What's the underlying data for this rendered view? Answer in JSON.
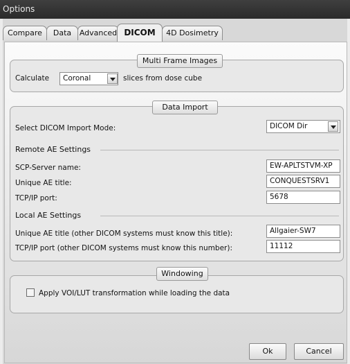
{
  "window": {
    "title": "Options"
  },
  "tabs": [
    "Compare",
    "Data",
    "Advanced",
    "DICOM",
    "4D Dosimetry"
  ],
  "multi_frame": {
    "title": "Multi Frame Images",
    "prefix": "Calculate",
    "orientation": "Coronal",
    "suffix": "slices from dose cube"
  },
  "data_import": {
    "title": "Data Import",
    "mode_label": "Select DICOM Import Mode:",
    "mode_value": "DICOM Dir",
    "remote_header": "Remote AE Settings",
    "scp_label": "SCP-Server name:",
    "scp_value": "EW-APLTSTVM-XP",
    "unique_ae_label": "Unique AE title:",
    "unique_ae_value": "CONQUESTSRV1",
    "tcp_label": "TCP/IP port:",
    "tcp_value": "5678",
    "local_header": "Local AE Settings",
    "local_ae_label": "Unique AE title (other DICOM systems must know this title):",
    "local_ae_value": "Allgaier-SW7",
    "local_port_label": "TCP/IP port (other DICOM systems must know this number):",
    "local_port_value": "11112"
  },
  "windowing": {
    "title": "Windowing",
    "checkbox_label": "Apply VOI/LUT transformation while loading the data",
    "checked": false
  },
  "buttons": {
    "ok": "Ok",
    "cancel": "Cancel"
  }
}
